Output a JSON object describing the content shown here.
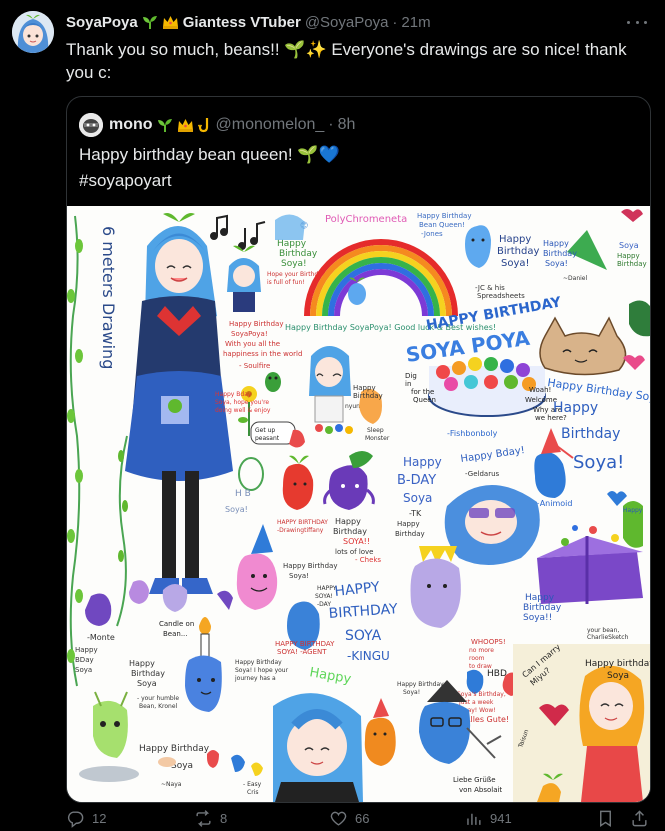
{
  "tweet": {
    "display_name": "SoyaPoya",
    "name_suffix": "Giantess VTuber",
    "handle": "@SoyaPoya",
    "separator": "·",
    "time": "21m",
    "text_line1": "Thank you so much, beans!! 🌱✨ Everyone's drawings are so nice! thank",
    "text_line2": "you c:"
  },
  "quote": {
    "display_name": "mono",
    "handle": "@monomelon_",
    "separator": "·",
    "time": "8h",
    "text_line1": "Happy birthday bean queen! 🌱💙",
    "text_line2": "#soyapoyart"
  },
  "image_texts": {
    "polychromeneta": "PolyChromeneta",
    "six_meters": "6 meters Drawing",
    "happy_bday_soya_1": "Happy Birthday Soya!",
    "happy_bday_soyapoya": "HAPPY BIRTHDAY SOYA POYA",
    "good_luck": "Happy Birthday SoyaPoya! Good luck & Best wishes!",
    "fishbonboly": "-Fishbonboly",
    "happy_birthday_hit": "Happy Birthday Soya! -Hit",
    "happy_birthday_soya_big": "Happy Birthday Soya!",
    "happy_bday_geldarus": "Happy Bday! -Geldarus",
    "happy_bday_tk": "Happy B-DAY Soya -TK",
    "happy_birthday_kingu": "HAPPY BIRTHDAY SOYA -KINGU",
    "happy_birthday_bottom": "Happy Birthday",
    "candle_text": "Candle on Bean...",
    "happy_bday_monte": "Happy BDay Soya -Monte",
    "whoops": "WHOOPS! no more room to draw",
    "hbd": "HBD",
    "alles_gute": "Soya's Birthday, Just a week away! Wow! Alles Gute!",
    "liebe": "Liebe Grüße von Absolait",
    "can_i_marry": "Can I marry Miyu?",
    "happy_birthday_soya_anime": "Happy birthday Soya",
    "happy_birthday_soya_box": "Happy Birthday Soya!!",
    "soya_hb": "Soya! HB",
    "happy_birthday_soya_small": "Happy Birthday Soya!"
  },
  "actions": {
    "replies": "12",
    "reposts": "8",
    "likes": "66",
    "views": "941"
  },
  "colors": {
    "background": "#000000",
    "text": "#e7e9ea",
    "muted": "#71767b",
    "border": "#2f3336",
    "soya_blue": "#5aa7e0",
    "sprout_green": "#5fb82e",
    "crown_gold": "#f5b800"
  },
  "icons": [
    "sprout-icon",
    "crown-icon",
    "sparkles-icon",
    "blue-heart-icon",
    "hook-icon",
    "more-icon",
    "reply-icon",
    "repost-icon",
    "like-icon",
    "views-icon",
    "bookmark-icon",
    "share-icon"
  ]
}
